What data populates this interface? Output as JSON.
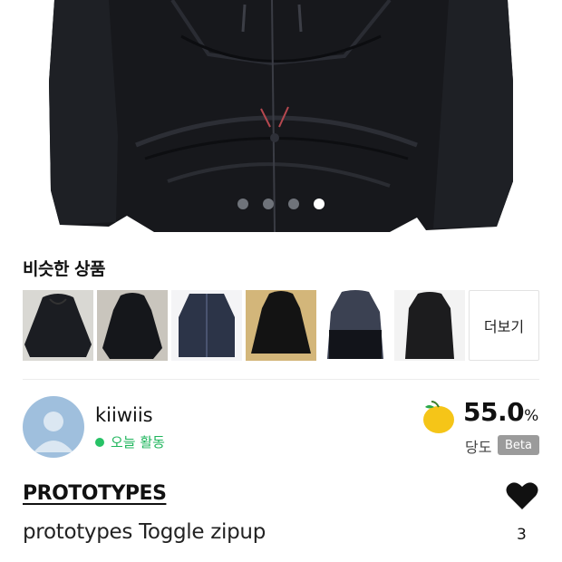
{
  "gallery": {
    "slide_count": 4,
    "active_index": 3
  },
  "similar": {
    "title": "비슷한 상품",
    "more_label": "더보기",
    "items": [
      {
        "name": "similar-item-1",
        "color": "#1b1d22"
      },
      {
        "name": "similar-item-2",
        "color": "#15171b"
      },
      {
        "name": "similar-item-3",
        "color": "#2c3448"
      },
      {
        "name": "similar-item-4",
        "color": "#131313"
      },
      {
        "name": "similar-item-5",
        "color": "#3b4152"
      },
      {
        "name": "similar-item-6",
        "color": "#1c1c1e"
      }
    ]
  },
  "seller": {
    "name": "kiiwiis",
    "status": "오늘 활동"
  },
  "sweetness": {
    "value": "55.0",
    "unit": "%",
    "label": "당도",
    "badge": "Beta",
    "icon": "apple-icon",
    "color": "#f5c518"
  },
  "product": {
    "brand": "PROTOTYPES",
    "title": "prototypes Toggle zipup",
    "likes": "3"
  },
  "colors": {
    "online": "#1fb55c",
    "badge": "#9b9b9b"
  }
}
